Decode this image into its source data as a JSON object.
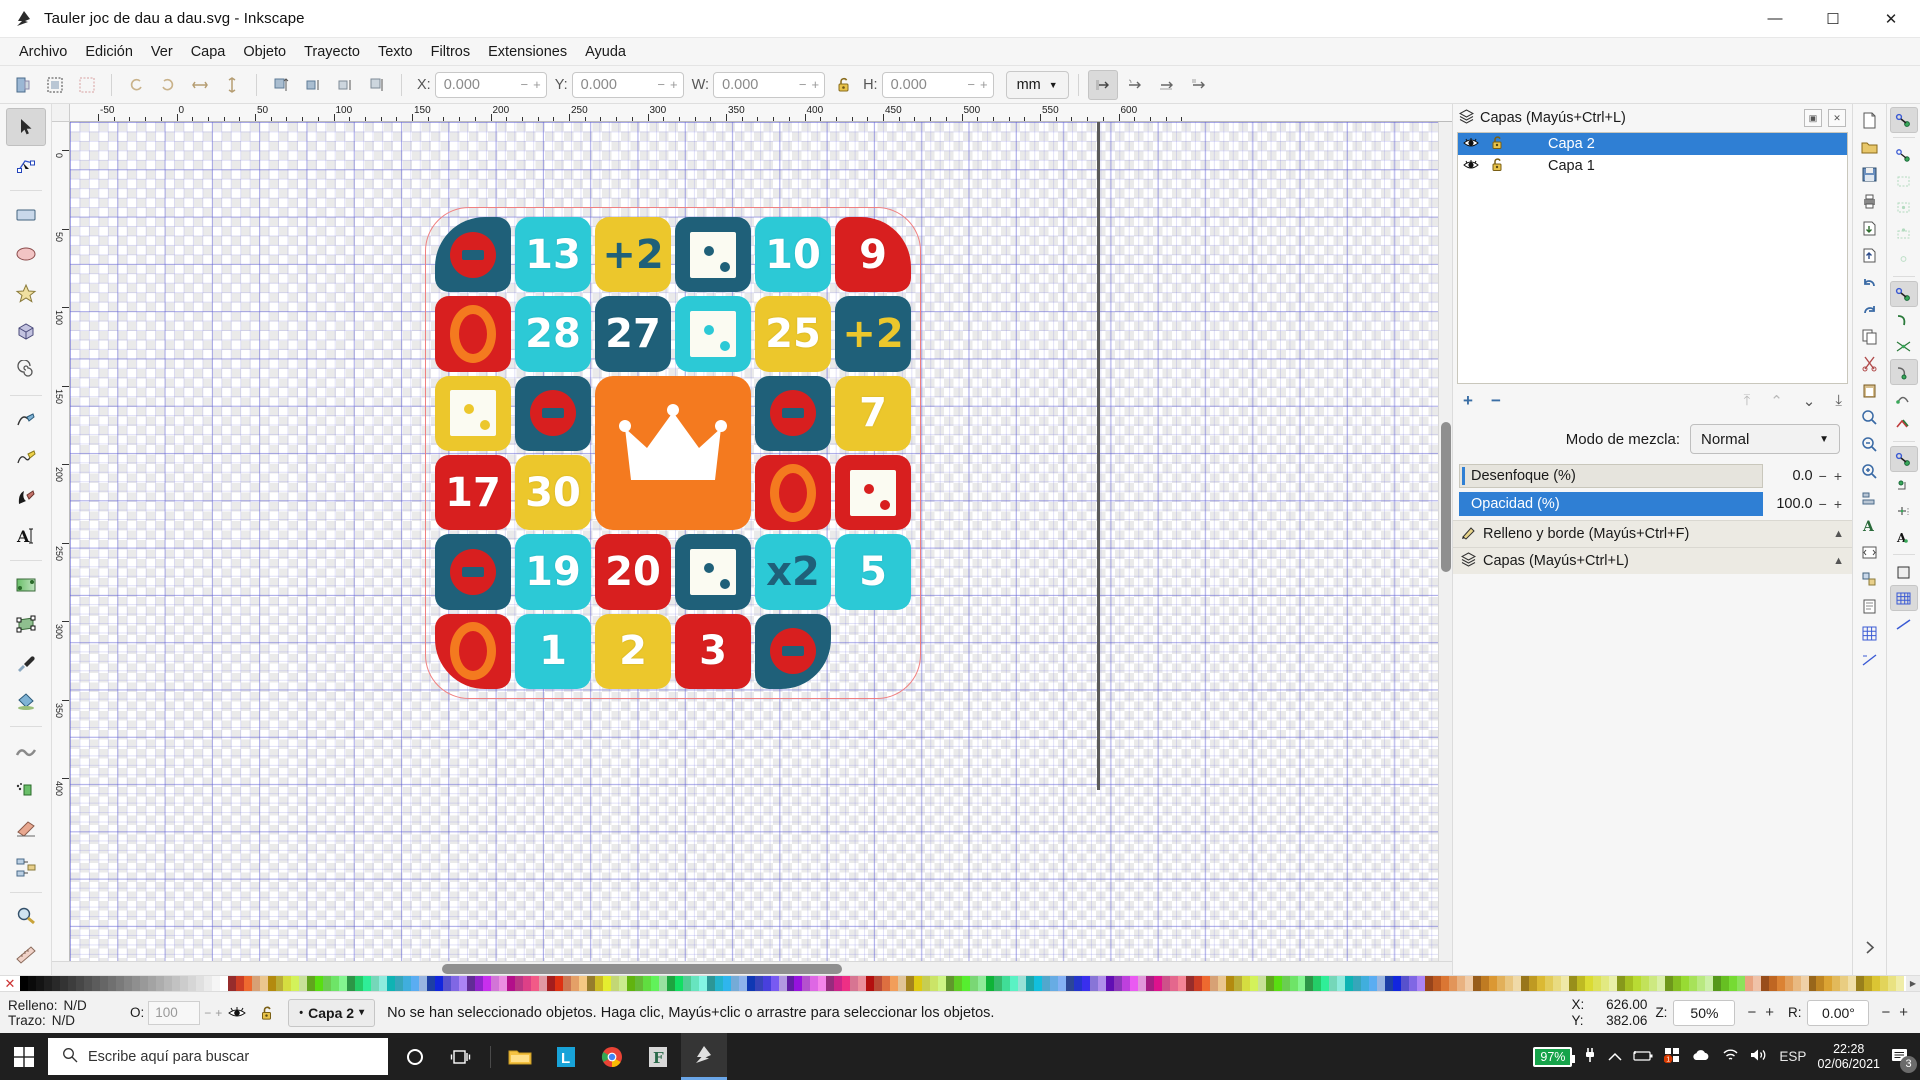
{
  "window": {
    "title": "Tauler joc de dau a dau.svg - Inkscape",
    "app_icon": "inkscape-logo-icon",
    "minimize": "—",
    "maximize": "☐",
    "close": "✕"
  },
  "menubar": {
    "items": [
      {
        "label": "Archivo",
        "name": "menu-archivo"
      },
      {
        "label": "Edición",
        "name": "menu-edicion"
      },
      {
        "label": "Ver",
        "name": "menu-ver"
      },
      {
        "label": "Capa",
        "name": "menu-capa"
      },
      {
        "label": "Objeto",
        "name": "menu-objeto"
      },
      {
        "label": "Trayecto",
        "name": "menu-trayecto"
      },
      {
        "label": "Texto",
        "name": "menu-texto"
      },
      {
        "label": "Filtros",
        "name": "menu-filtros"
      },
      {
        "label": "Extensiones",
        "name": "menu-extensiones"
      },
      {
        "label": "Ayuda",
        "name": "menu-ayuda"
      }
    ]
  },
  "toolbar": {
    "x_label": "X:",
    "x_value": "0.000",
    "y_label": "Y:",
    "y_value": "0.000",
    "w_label": "W:",
    "w_value": "0.000",
    "h_label": "H:",
    "h_value": "0.000",
    "unit": "mm",
    "lock_icon": "unlocked-padlock-icon",
    "minus": "−",
    "plus": "+"
  },
  "rulers": {
    "horizontal_labels": [
      "-50",
      "0",
      "50",
      "100",
      "150",
      "200",
      "250",
      "300",
      "350",
      "400",
      "450",
      "500",
      "550",
      "600"
    ],
    "vertical_labels": [
      "0",
      "50",
      "100",
      "150",
      "200",
      "250",
      "300",
      "350",
      "400"
    ]
  },
  "layers_panel": {
    "header_title": "Capas (Mayús+Ctrl+L)",
    "header_icon": "layers-icon",
    "dock_button": "▣",
    "close_button": "✕",
    "rows": [
      {
        "name": "Capa 2",
        "visible_icon": "eye-icon",
        "lock_icon": "unlocked-padlock-icon",
        "selected": true
      },
      {
        "name": "Capa 1",
        "visible_icon": "eye-icon",
        "lock_icon": "unlocked-padlock-icon",
        "selected": false
      }
    ],
    "add_label": "+",
    "remove_label": "−",
    "raise_top": "⤒",
    "raise": "⌃",
    "lower": "⌄",
    "lower_bottom": "⤓",
    "blend_label": "Modo de mezcla:",
    "blend_value": "Normal",
    "blur_label": "Desenfoque (%)",
    "blur_value": "0.0",
    "opacity_label": "Opacidad (%)",
    "opacity_value": "100.0",
    "sections": [
      {
        "label": "Relleno y borde (Mayús+Ctrl+F)",
        "icon": "fill-stroke-icon"
      },
      {
        "label": "Capas (Mayús+Ctrl+L)",
        "icon": "layers-icon"
      }
    ]
  },
  "toolbox": {
    "tools": [
      {
        "name": "selector-tool",
        "selected": true
      },
      {
        "name": "node-tool",
        "selected": false
      },
      {
        "name": "rectangle-tool",
        "selected": false
      },
      {
        "name": "ellipse-tool",
        "selected": false
      },
      {
        "name": "star-tool",
        "selected": false
      },
      {
        "name": "box-3d-tool",
        "selected": false
      },
      {
        "name": "spiral-tool",
        "selected": false
      },
      {
        "name": "pencil-tool",
        "selected": false
      },
      {
        "name": "bezier-tool",
        "selected": false
      },
      {
        "name": "calligraphy-tool",
        "selected": false
      },
      {
        "name": "text-tool",
        "selected": false
      },
      {
        "name": "gradient-tool",
        "selected": false
      },
      {
        "name": "mesh-tool",
        "selected": false
      },
      {
        "name": "dropper-tool",
        "selected": false
      },
      {
        "name": "paint-bucket-tool",
        "selected": false
      },
      {
        "name": "tweak-tool",
        "selected": false
      },
      {
        "name": "spray-tool",
        "selected": false
      },
      {
        "name": "eraser-tool",
        "selected": false
      },
      {
        "name": "connector-tool",
        "selected": false
      },
      {
        "name": "zoom-tool",
        "selected": false
      },
      {
        "name": "measure-tool",
        "selected": false
      }
    ]
  },
  "statusbar": {
    "fill_label": "Relleno:",
    "fill_value": "N/D",
    "stroke_label": "Trazo:",
    "stroke_value": "N/D",
    "opacity_label": "O:",
    "opacity_value": "100",
    "minus": "−",
    "plus": "+",
    "eye_icon": "eye-icon",
    "lock_icon": "unlocked-padlock-icon",
    "layer_name": "Capa 2",
    "layer_caret": "▾",
    "message": "No se han seleccionado objetos. Haga clic, Mayús+clic o arrastre para seleccionar los objetos.",
    "x_label": "X:",
    "x_value": "626.00",
    "y_label": "Y:",
    "y_value": "382.06",
    "z_label": "Z:",
    "zoom_value": "50%",
    "r_label": "R:",
    "rotation_value": "0.00°"
  },
  "taskbar": {
    "start_icon": "windows-logo-icon",
    "search_placeholder": "Escribe aquí para buscar",
    "search_icon": "search-icon",
    "items": [
      {
        "name": "cortana-icon",
        "glyph": "○"
      },
      {
        "name": "task-view-icon",
        "glyph": "⌷"
      },
      {
        "name": "file-explorer-icon",
        "glyph": ""
      },
      {
        "name": "libreoffice-icon",
        "glyph": "L"
      },
      {
        "name": "chrome-icon",
        "glyph": ""
      },
      {
        "name": "fontforge-icon",
        "glyph": "F"
      },
      {
        "name": "inkscape-icon",
        "glyph": ""
      }
    ],
    "tray": {
      "battery_percent": "97%",
      "power_icon": "power-plug-icon",
      "chevron_icon": "chevron-up-icon",
      "battery_icon": "battery-icon",
      "update_icon": "windows-update-icon",
      "onedrive_icon": "onedrive-cloud-icon",
      "wifi_icon": "wifi-icon",
      "volume_icon": "speaker-icon",
      "language": "ESP",
      "time": "22:28",
      "date": "02/06/2021",
      "notification_icon": "notification-icon",
      "notification_count": "3"
    }
  },
  "artwork": {
    "name": "dice-board-game-svg",
    "colors": {
      "teal_dark": "#1f6079",
      "cyan": "#2cc9d6",
      "yellow": "#ecc72c",
      "red": "#d81f1f",
      "orange": "#f47a1f",
      "white": "#ffffff",
      "page_border": "#f08080"
    },
    "tiles": [
      {
        "row": 1,
        "col": 1,
        "bg": "teal_dark",
        "kind": "stop",
        "stop_bg": "red",
        "stop_bar": "teal_dark",
        "corner": "tl"
      },
      {
        "row": 1,
        "col": 2,
        "bg": "cyan",
        "kind": "number",
        "text": "13",
        "text_color": "white"
      },
      {
        "row": 1,
        "col": 3,
        "bg": "yellow",
        "kind": "number",
        "text": "+2",
        "text_color": "teal_dark"
      },
      {
        "row": 1,
        "col": 4,
        "bg": "teal_dark",
        "kind": "die",
        "pips": 2,
        "pip_color": "teal_dark"
      },
      {
        "row": 1,
        "col": 5,
        "bg": "cyan",
        "kind": "number",
        "text": "10",
        "text_color": "white"
      },
      {
        "row": 1,
        "col": 6,
        "bg": "red",
        "kind": "number",
        "text": "9",
        "text_color": "white",
        "corner": "tr"
      },
      {
        "row": 2,
        "col": 1,
        "bg": "red",
        "kind": "ring",
        "ring_color": "orange"
      },
      {
        "row": 2,
        "col": 2,
        "bg": "cyan",
        "kind": "number",
        "text": "28",
        "text_color": "white"
      },
      {
        "row": 2,
        "col": 3,
        "bg": "teal_dark",
        "kind": "number",
        "text": "27",
        "text_color": "white"
      },
      {
        "row": 2,
        "col": 4,
        "bg": "cyan",
        "kind": "die",
        "pips": 2,
        "pip_color": "cyan"
      },
      {
        "row": 2,
        "col": 5,
        "bg": "yellow",
        "kind": "number",
        "text": "25",
        "text_color": "white"
      },
      {
        "row": 2,
        "col": 6,
        "bg": "teal_dark",
        "kind": "number",
        "text": "+2",
        "text_color": "yellow"
      },
      {
        "row": 3,
        "col": 1,
        "bg": "yellow",
        "kind": "die",
        "pips": 2,
        "pip_color": "yellow"
      },
      {
        "row": 3,
        "col": 2,
        "bg": "teal_dark",
        "kind": "stop",
        "stop_bg": "red",
        "stop_bar": "teal_dark"
      },
      {
        "row": 3,
        "col": 3,
        "bg": "orange",
        "kind": "crown",
        "span": 2
      },
      {
        "row": 3,
        "col": 5,
        "bg": "teal_dark",
        "kind": "stop",
        "stop_bg": "red",
        "stop_bar": "teal_dark"
      },
      {
        "row": 3,
        "col": 6,
        "bg": "yellow",
        "kind": "number",
        "text": "7",
        "text_color": "white"
      },
      {
        "row": 4,
        "col": 1,
        "bg": "red",
        "kind": "number",
        "text": "17",
        "text_color": "white"
      },
      {
        "row": 4,
        "col": 2,
        "bg": "yellow",
        "kind": "number",
        "text": "30",
        "text_color": "white"
      },
      {
        "row": 4,
        "col": 5,
        "bg": "red",
        "kind": "ring",
        "ring_color": "orange"
      },
      {
        "row": 4,
        "col": 6,
        "bg": "red",
        "kind": "die",
        "pips": 2,
        "pip_color": "red"
      },
      {
        "row": 5,
        "col": 1,
        "bg": "teal_dark",
        "kind": "stop",
        "stop_bg": "red",
        "stop_bar": "teal_dark"
      },
      {
        "row": 5,
        "col": 2,
        "bg": "cyan",
        "kind": "number",
        "text": "19",
        "text_color": "white"
      },
      {
        "row": 5,
        "col": 3,
        "bg": "red",
        "kind": "number",
        "text": "20",
        "text_color": "white"
      },
      {
        "row": 5,
        "col": 4,
        "bg": "teal_dark",
        "kind": "die",
        "pips": 2,
        "pip_color": "teal_dark"
      },
      {
        "row": 5,
        "col": 5,
        "bg": "cyan",
        "kind": "number",
        "text": "x2",
        "text_color": "teal_dark"
      },
      {
        "row": 5,
        "col": 6,
        "bg": "cyan",
        "kind": "number",
        "text": "5",
        "text_color": "white"
      },
      {
        "row": 6,
        "col": 1,
        "bg": "red",
        "kind": "ring",
        "ring_color": "orange",
        "corner": "bl"
      },
      {
        "row": 6,
        "col": 2,
        "bg": "cyan",
        "kind": "number",
        "text": "1",
        "text_color": "white"
      },
      {
        "row": 6,
        "col": 3,
        "bg": "yellow",
        "kind": "number",
        "text": "2",
        "text_color": "white"
      },
      {
        "row": 6,
        "col": 4,
        "bg": "red",
        "kind": "number",
        "text": "3",
        "text_color": "white"
      },
      {
        "row": 6,
        "col": 5,
        "bg": "teal_dark",
        "kind": "stop",
        "stop_bg": "red",
        "stop_bar": "teal_dark",
        "corner": "br"
      }
    ]
  }
}
